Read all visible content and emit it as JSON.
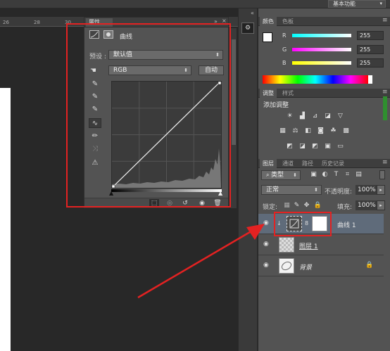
{
  "topbar": {
    "workspace": "基本功能"
  },
  "ruler": {
    "ticks": [
      "26",
      "28",
      "30"
    ]
  },
  "properties": {
    "tab": "属性",
    "title": "曲线",
    "preset_label": "预设 :",
    "preset_value": "默认值",
    "channel_value": "RGB",
    "auto_button": "自动"
  },
  "color_panel": {
    "tabs": [
      "颜色",
      "色板"
    ],
    "r_label": "R",
    "g_label": "G",
    "b_label": "B",
    "r_value": "255",
    "g_value": "255",
    "b_value": "255"
  },
  "adjustments_panel": {
    "tabs": [
      "调整",
      "样式"
    ],
    "heading": "添加调整"
  },
  "layers_panel": {
    "tabs": [
      "图层",
      "通道",
      "路径",
      "历史记录"
    ],
    "filter_kind": "类型",
    "blend_mode": "正常",
    "opacity_label": "不透明度:",
    "opacity_value": "100%",
    "lock_label": "锁定:",
    "fill_label": "填充:",
    "fill_value": "100%",
    "layers": [
      {
        "name": "曲线 1"
      },
      {
        "name": "图层 1"
      },
      {
        "name": "背景"
      }
    ]
  }
}
